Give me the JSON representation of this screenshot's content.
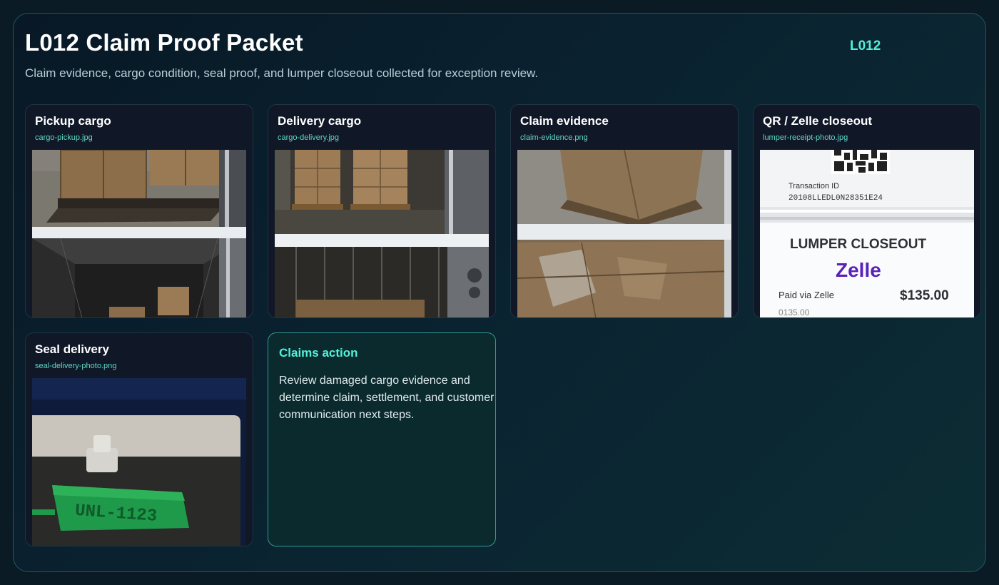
{
  "header": {
    "title": "L012 Claim Proof Packet",
    "load_id": "L012",
    "subtitle": "Claim evidence, cargo condition, seal proof, and lumper closeout collected for exception review."
  },
  "cards": [
    {
      "title": "Pickup cargo",
      "file": "cargo-pickup.jpg"
    },
    {
      "title": "Delivery cargo",
      "file": "cargo-delivery.jpg"
    },
    {
      "title": "Claim evidence",
      "file": "claim-evidence.png"
    },
    {
      "title": "QR / Zelle closeout",
      "file": "lumper-receipt-photo.jpg"
    },
    {
      "title": "Seal delivery",
      "file": "seal-delivery-photo.png"
    }
  ],
  "receipt": {
    "transaction_label": "Transaction ID",
    "transaction_id": "20108LLEDL0N28351E24",
    "heading": "LUMPER CLOSEOUT",
    "brand": "Zelle",
    "paid_label": "Paid via Zelle",
    "amount": "$135.00",
    "amount_small": "0135.00"
  },
  "seal": {
    "code": "UNL-1123"
  },
  "action": {
    "title": "Claims action",
    "body": "Review damaged cargo evidence and determine claim, settlement, and customer communication next steps."
  },
  "colors": {
    "accent": "#52f0d8",
    "zelle_purple": "#5a22b8",
    "seal_green": "#1f9a4a"
  }
}
